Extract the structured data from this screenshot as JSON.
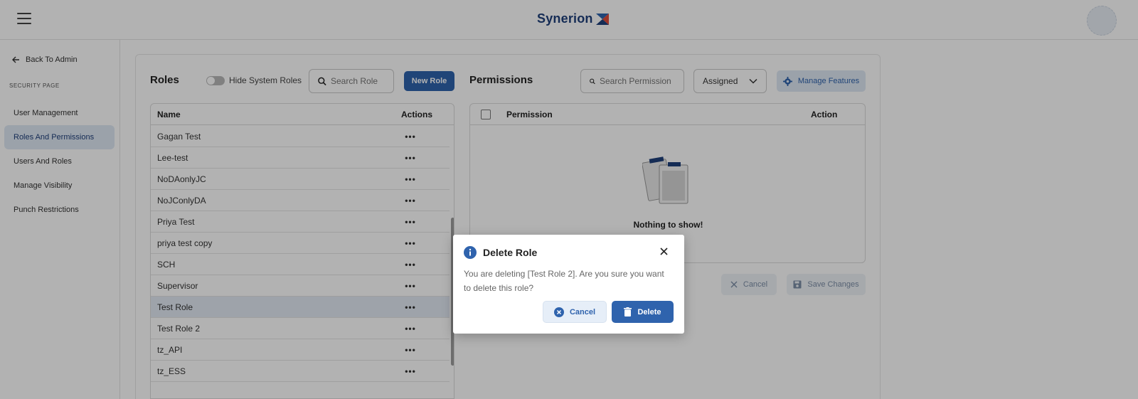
{
  "header": {
    "logo_text": "Synerion",
    "brand_color": "#1f3f7a"
  },
  "sidebar": {
    "back_label": "Back To Admin",
    "section_label": "SECURITY PAGE",
    "items": [
      {
        "label": "User Management",
        "active": false
      },
      {
        "label": "Roles And Permissions",
        "active": true
      },
      {
        "label": "Users And Roles",
        "active": false
      },
      {
        "label": "Manage Visibility",
        "active": false
      },
      {
        "label": "Punch Restrictions",
        "active": false
      }
    ]
  },
  "roles": {
    "title": "Roles",
    "hide_system_label": "Hide System Roles",
    "hide_system_on": false,
    "search_placeholder": "Search Role",
    "new_role_label": "New Role",
    "columns": {
      "name": "Name",
      "actions": "Actions"
    },
    "rows": [
      {
        "name": "Gagan Test",
        "actions": "•••"
      },
      {
        "name": "Lee-test",
        "actions": "•••"
      },
      {
        "name": "NoDAonlyJC",
        "actions": "•••"
      },
      {
        "name": "NoJConlyDA",
        "actions": "•••"
      },
      {
        "name": "Priya Test",
        "actions": "•••"
      },
      {
        "name": "priya test copy",
        "actions": "•••"
      },
      {
        "name": "SCH",
        "actions": "•••"
      },
      {
        "name": "Supervisor",
        "actions": "•••"
      },
      {
        "name": "Test Role",
        "actions": "•••",
        "selected": true
      },
      {
        "name": "Test Role 2",
        "actions": "•••"
      },
      {
        "name": "tz_API",
        "actions": "•••"
      },
      {
        "name": "tz_ESS",
        "actions": "•••"
      }
    ]
  },
  "permissions": {
    "title": "Permissions",
    "search_placeholder": "Search Permission",
    "filter_value": "Assigned",
    "manage_features_label": "Manage Features",
    "columns": {
      "permission": "Permission",
      "action": "Action"
    },
    "empty_text": "Nothing to show!",
    "cancel_label": "Cancel",
    "save_label": "Save Changes"
  },
  "dialog": {
    "title": "Delete Role",
    "message": "You are deleting [Test Role 2]. Are you sure you want to delete this role?",
    "cancel_label": "Cancel",
    "delete_label": "Delete",
    "accent_color": "#2f63ad"
  },
  "icons": {
    "menu": "hamburger-icon",
    "back": "arrow-left-icon",
    "search": "search-icon",
    "gear": "gear-icon",
    "chevron": "chevron-down-icon",
    "info": "info-icon",
    "close": "close-icon",
    "cancel": "x-circle-icon",
    "delete": "trash-icon",
    "save": "floppy-icon"
  }
}
